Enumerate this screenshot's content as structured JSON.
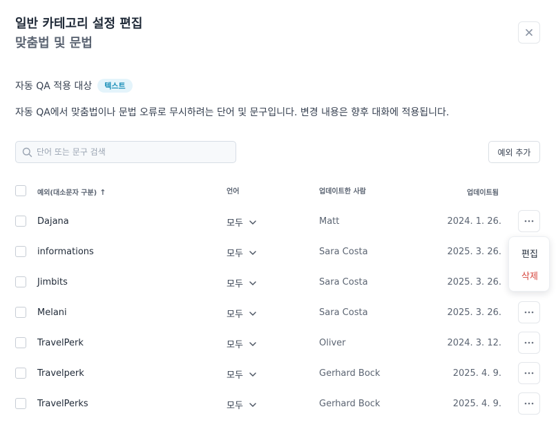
{
  "header": {
    "title": "일반 카테고리 설정 편집",
    "subtitle": "맞춤법 및 문법"
  },
  "qa": {
    "label": "자동 QA 적용 대상",
    "badge": "텍스트"
  },
  "description": "자동 QA에서 맞춤법이나 문법 오류로 무시하려는 단어 및 문구입니다. 변경 내용은 향후 대화에 적용됩니다.",
  "search": {
    "placeholder": "단어 또는 문구 검색"
  },
  "add_button": "예외 추가",
  "table": {
    "columns": {
      "exception": "예외(대소문자 구분)",
      "sort_arrow": "↑",
      "language": "언어",
      "updated_by": "업데이트한 사람",
      "updated": "업데이트됨"
    },
    "rows": [
      {
        "name": "Dajana",
        "language": "모두",
        "user": "Matt",
        "date": "2024. 1. 26."
      },
      {
        "name": "informations",
        "language": "모두",
        "user": "Sara Costa",
        "date": "2025. 3. 26."
      },
      {
        "name": "Jimbits",
        "language": "모두",
        "user": "Sara Costa",
        "date": "2025. 3. 26."
      },
      {
        "name": "Melani",
        "language": "모두",
        "user": "Sara Costa",
        "date": "2025. 3. 26."
      },
      {
        "name": "TravelPerk",
        "language": "모두",
        "user": "Oliver",
        "date": "2024. 3. 12."
      },
      {
        "name": "Travelperk",
        "language": "모두",
        "user": "Gerhard Bock",
        "date": "2025. 4. 9."
      },
      {
        "name": "TravelPerks",
        "language": "모두",
        "user": "Gerhard Bock",
        "date": "2025. 4. 9."
      }
    ]
  },
  "context_menu": {
    "edit": "편집",
    "delete": "삭제"
  },
  "colors": {
    "badge_bg": "#e4f4fb",
    "badge_text": "#1b8fb8",
    "delete_text": "#d6453d"
  }
}
